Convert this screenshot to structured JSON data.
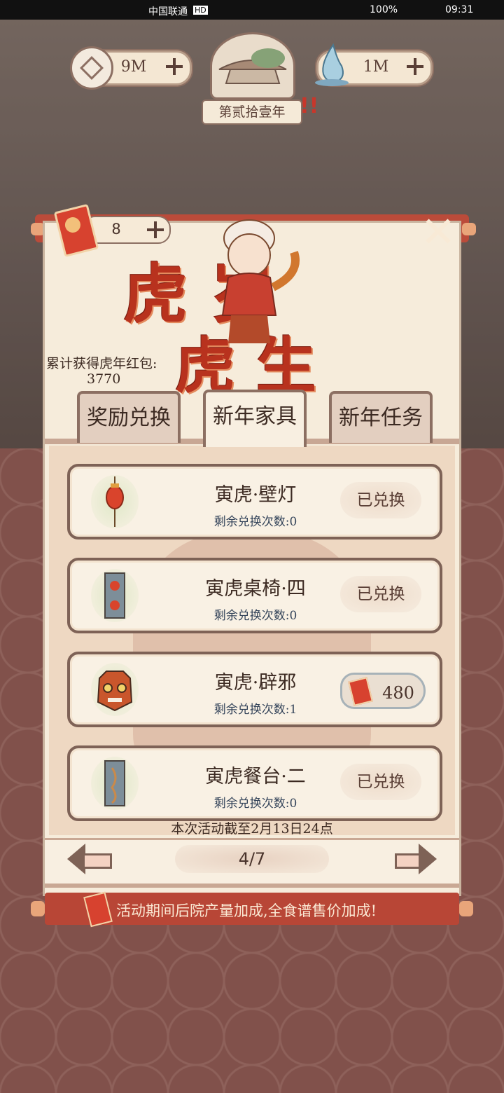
{
  "status_bar": {
    "carrier": "中国联通",
    "hd": "HD",
    "battery": "100%",
    "time": "09:31"
  },
  "top_bar": {
    "coins": "9M",
    "water": "1M",
    "year": "第贰拾壹年",
    "alert": "!!"
  },
  "panel": {
    "red_packet_count": "8",
    "title_line1": "虎 岁",
    "title_line2": "虎 生",
    "cumulative_label": "累计获得虎年红包:",
    "cumulative_value": "3770",
    "tabs": [
      {
        "label": "奖励兑换",
        "active": false
      },
      {
        "label": "新年家具",
        "active": true
      },
      {
        "label": "新年任务",
        "active": false
      }
    ],
    "items": [
      {
        "name": "寅虎·壁灯",
        "remaining": "剩余兑换次数:0",
        "button": "已兑换",
        "icon": "lantern-icon"
      },
      {
        "name": "寅虎桌椅·四",
        "remaining": "剩余兑换次数:0",
        "button": "已兑换",
        "icon": "table-chair-icon"
      },
      {
        "name": "寅虎·辟邪",
        "remaining": "剩余兑换次数:1",
        "button": "480",
        "icon": "tiger-mask-icon"
      },
      {
        "name": "寅虎餐台·二",
        "remaining": "剩余兑换次数:0",
        "button": "已兑换",
        "icon": "dining-table-icon"
      }
    ],
    "deadline": "本次活动截至2月13日24点",
    "page": "4/7",
    "banner": "活动期间后院产量加成,全食谱售价加成!"
  },
  "colors": {
    "panel_red": "#bb4b3a",
    "paper": "#f6ecdb",
    "border_brown": "#7e6256"
  }
}
